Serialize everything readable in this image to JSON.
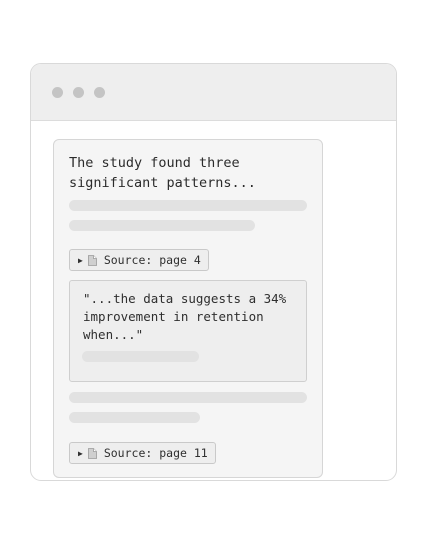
{
  "window": {
    "controls": [
      "window-dot",
      "window-dot",
      "window-dot"
    ]
  },
  "card": {
    "lead_text": "The study found three\nsignificant patterns...",
    "sources": [
      {
        "label": "Source: page 4",
        "icon": "document-icon",
        "expand_icon": "play-triangle-icon"
      },
      {
        "label": "Source: page 11",
        "icon": "document-icon",
        "expand_icon": "play-triangle-icon"
      }
    ],
    "quote": {
      "text": "\"...the data suggests a 34%\nimprovement in retention\nwhen...\""
    }
  },
  "colors": {
    "titlebar": "#eeeeee",
    "dots": "#c4c4c4",
    "card_bg": "#f5f5f5",
    "placeholder": "#e2e2e2",
    "text": "#2b2b2b"
  }
}
